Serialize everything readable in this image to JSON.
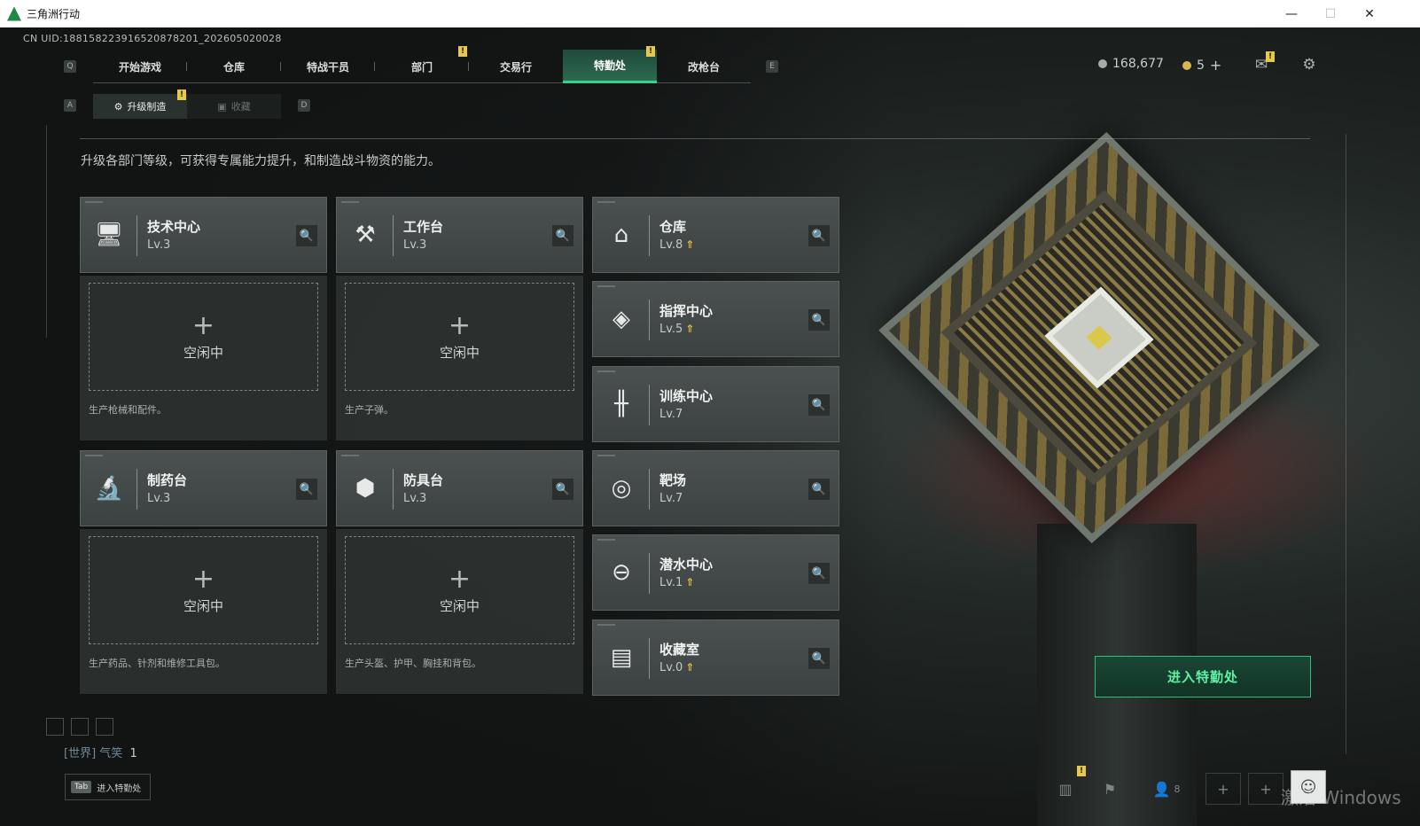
{
  "window": {
    "title": "三角洲行动",
    "minimize": "—",
    "maximize": "☐",
    "close": "✕"
  },
  "uid": "CN UID:188158223916520878201_202605020028",
  "nav": {
    "key_left": "Q",
    "key_right": "E",
    "tabs": [
      "开始游戏",
      "仓库",
      "特战干员",
      "部门",
      "交易行",
      "特勤处",
      "改枪台"
    ],
    "active": "特勤处",
    "badge": "!"
  },
  "currency": {
    "coins": "168,677",
    "tickets": "5",
    "add": "+"
  },
  "subnav": {
    "key_left": "A",
    "key_right": "D",
    "tabs": [
      "升级制造",
      "收藏"
    ],
    "active": "升级制造"
  },
  "description": "升级各部门等级，可获得专属能力提升，和制造战斗物资的能力。",
  "production_departments": [
    {
      "name": "技术中心",
      "level": "Lv.3",
      "icon": "computer-icon",
      "idle": "空闲中",
      "produce": "生产枪械和配件。"
    },
    {
      "name": "工作台",
      "level": "Lv.3",
      "icon": "tools-icon",
      "idle": "空闲中",
      "produce": "生产子弹。"
    },
    {
      "name": "制药台",
      "level": "Lv.3",
      "icon": "microscope-icon",
      "idle": "空闲中",
      "produce": "生产药品、针剂和维修工具包。"
    },
    {
      "name": "防具台",
      "level": "Lv.3",
      "icon": "armor-blocks-icon",
      "idle": "空闲中",
      "produce": "生产头盔、护甲、胸挂和背包。"
    }
  ],
  "other_departments": [
    {
      "name": "仓库",
      "level": "Lv.8",
      "upgradable": true,
      "icon": "warehouse-icon"
    },
    {
      "name": "指挥中心",
      "level": "Lv.5",
      "upgradable": true,
      "icon": "command-icon"
    },
    {
      "name": "训练中心",
      "level": "Lv.7",
      "upgradable": false,
      "icon": "dumbbell-icon"
    },
    {
      "name": "靶场",
      "level": "Lv.7",
      "upgradable": false,
      "icon": "target-icon"
    },
    {
      "name": "潜水中心",
      "level": "Lv.1",
      "upgradable": true,
      "icon": "diving-mask-icon"
    },
    {
      "name": "收藏室",
      "level": "Lv.0",
      "upgradable": true,
      "icon": "collection-icon"
    }
  ],
  "enter_button": "进入特勤处",
  "chat": {
    "channel": "[世界]",
    "user": "气笑",
    "message": "1"
  },
  "tab_hint": {
    "key": "Tab",
    "label": "进入特勤处"
  },
  "bottom": {
    "friends_count": "8",
    "watermark": "激活 Windows"
  },
  "colors": {
    "accent_green": "#35d28a",
    "upgrade_gold": "#e3b942",
    "alert_yellow": "#e8c84a"
  }
}
